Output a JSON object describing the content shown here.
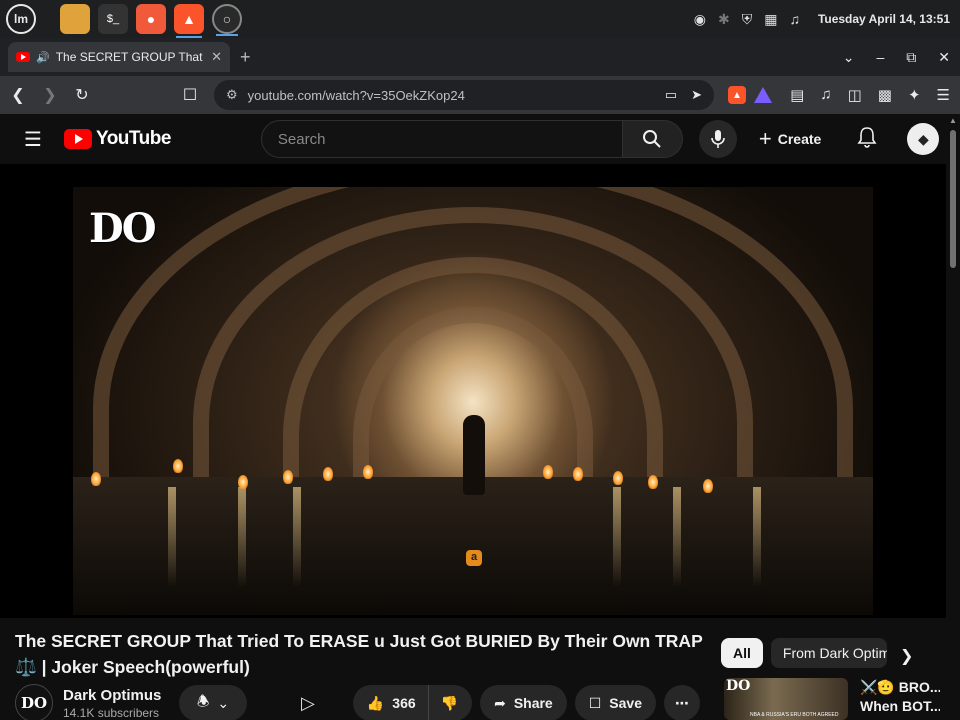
{
  "os": {
    "clock": "Tuesday April 14, 13:51"
  },
  "browser": {
    "tab_title": "The SECRET GROUP That T",
    "url": "youtube.com/watch?v=35OekZKop24"
  },
  "youtube": {
    "logo_text": "YouTube",
    "search_placeholder": "Search",
    "create_label": "Create"
  },
  "video": {
    "watermark": "DO",
    "title": "The SECRET GROUP That Tried To ERASE u Just Got BURIED By Their Own TRAP ⚖️ | Joker Speech(powerful)",
    "channel_avatar": "DO",
    "channel_name": "Dark Optimus",
    "subscribers": "14.1K subscribers",
    "likes": "366",
    "share_label": "Share",
    "save_label": "Save"
  },
  "sidebar": {
    "chips": [
      "All",
      "From Dark Optim"
    ],
    "recommendation": {
      "thumb_label": "DO",
      "thumb_caption": "NBA & RUSSIA'S ERU BOTH AGREED",
      "title_line1": "⚔️🫡 BRO...",
      "title_line2": "When BOT..."
    }
  }
}
